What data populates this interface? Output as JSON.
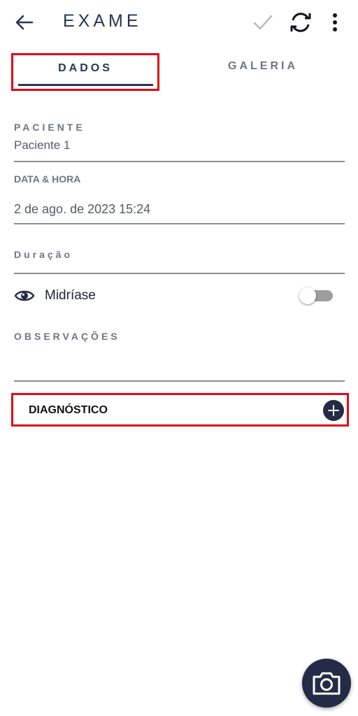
{
  "toolbar": {
    "title": "EXAME",
    "back_icon": "arrow-left-icon",
    "save_icon": "check-icon",
    "sync_icon": "sync-icon",
    "more_icon": "more-vert-icon"
  },
  "tabs": [
    {
      "label": "DADOS",
      "selected": true
    },
    {
      "label": "GALERIA",
      "selected": false
    }
  ],
  "fields": {
    "paciente": {
      "label": "PACIENTE",
      "value": "Paciente 1"
    },
    "data_hora": {
      "label": "DATA & HORA",
      "value": "2 de ago. de 2023 15:24"
    },
    "duracao": {
      "label": "Duração",
      "value": ""
    },
    "midriase": {
      "label": "Midríase",
      "icon": "eye-icon",
      "enabled": false
    },
    "observacoes": {
      "label": "OBSERVAÇÕES",
      "value": ""
    }
  },
  "diagnostico": {
    "label": "DIAGNÓSTICO",
    "add_icon": "plus-circle-icon"
  },
  "fab": {
    "icon": "camera-icon"
  },
  "colors": {
    "primary": "#232b47",
    "highlight_border": "#e10a17",
    "muted_text": "#70757e"
  }
}
